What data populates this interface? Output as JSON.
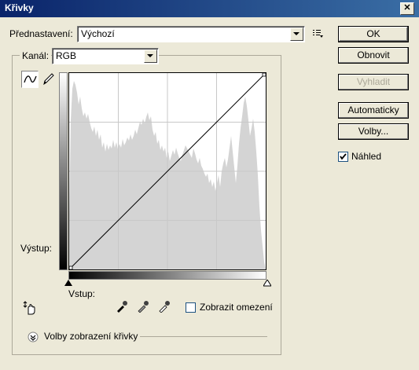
{
  "window": {
    "title": "Křivky",
    "close_glyph": "✕"
  },
  "preset": {
    "label": "Přednastavení:",
    "value": "Výchozí"
  },
  "channel": {
    "label": "Kanál:",
    "value": "RGB"
  },
  "buttons": {
    "ok": "OK",
    "reset": "Obnovit",
    "smooth": "Vyhladit",
    "auto": "Automaticky",
    "options": "Volby..."
  },
  "preview": {
    "label": "Náhled",
    "checked": true
  },
  "output_label": "Výstup:",
  "input_label": "Vstup:",
  "clipping": {
    "label": "Zobrazit omezení",
    "checked": false
  },
  "display_options": "Volby zobrazení křivky",
  "colors": {
    "title_start": "#0a246a",
    "title_end": "#3a6ea5",
    "histogram": "#d4d4d4",
    "dialog_bg": "#ece9d8"
  },
  "icons": [
    "curve-tool-icon",
    "pencil-icon",
    "preset-menu-icon",
    "hand-adjust-icon",
    "black-eyedropper-icon",
    "gray-eyedropper-icon",
    "white-eyedropper-icon",
    "expand-chevron-icon"
  ]
}
